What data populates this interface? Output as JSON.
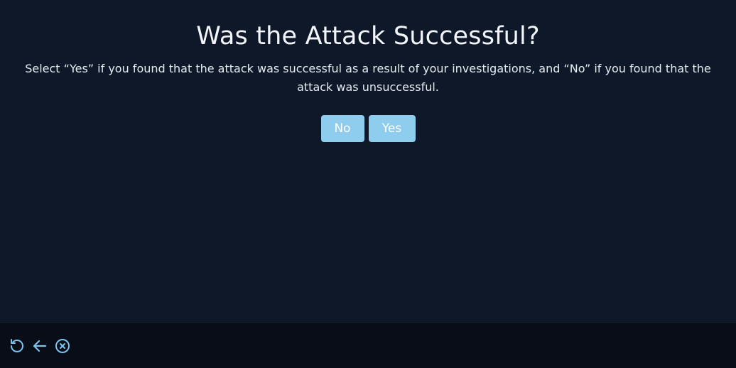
{
  "dialog": {
    "title": "Was the Attack Successful?",
    "description": "Select “Yes” if you found that the attack was successful as a result of your investigations, and “No” if you found that the attack was unsuccessful.",
    "no_label": "No",
    "yes_label": "Yes"
  },
  "footer": {
    "icons": [
      "reset-icon",
      "back-arrow-icon",
      "close-circle-icon"
    ]
  },
  "colors": {
    "background": "#0f1829",
    "footer_background": "#080d18",
    "button": "#8fcdef",
    "icon": "#7cc4ee"
  }
}
